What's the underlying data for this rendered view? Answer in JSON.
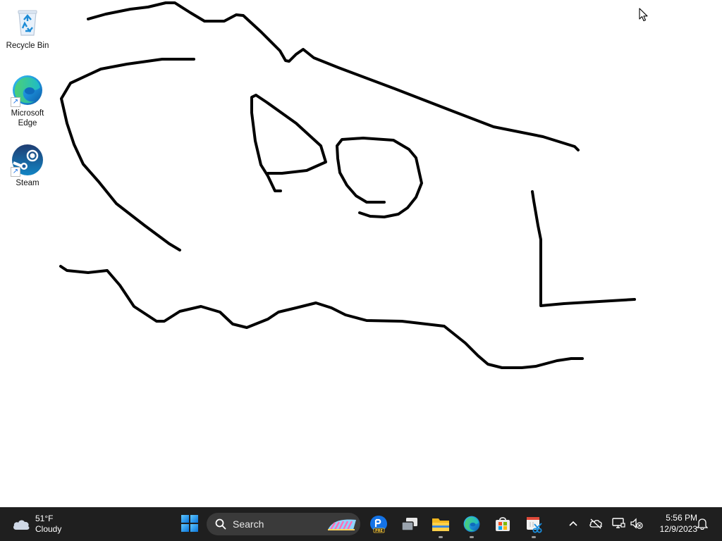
{
  "desktop": {
    "icons": [
      {
        "label": "Recycle Bin",
        "icon": "recycle-bin-icon"
      },
      {
        "label": "Microsoft Edge",
        "icon": "edge-icon"
      },
      {
        "label": "Steam",
        "icon": "steam-icon"
      }
    ]
  },
  "taskbar": {
    "weather": {
      "temp": "51°F",
      "condition": "Cloudy",
      "icon": "cloud-icon"
    },
    "search": {
      "label": "Search"
    },
    "apps": [
      {
        "name": "Photoshop Express",
        "icon": "photoshop-icon",
        "badge": "PRE"
      },
      {
        "name": "Task View",
        "icon": "task-view-icon"
      },
      {
        "name": "File Explorer",
        "icon": "folder-icon"
      },
      {
        "name": "Microsoft Edge",
        "icon": "edge-icon"
      },
      {
        "name": "Microsoft Store",
        "icon": "store-icon"
      },
      {
        "name": "Snipping Tool",
        "icon": "snipping-tool-icon"
      }
    ],
    "tray": [
      {
        "icon": "chevron-up-icon"
      },
      {
        "icon": "onedrive-off-icon"
      },
      {
        "icon": "network-icon"
      },
      {
        "icon": "volume-muted-icon"
      }
    ],
    "clock": {
      "time": "5:56 PM",
      "date": "12/9/2023"
    },
    "notifications_icon": "bell-icon"
  },
  "colors": {
    "desktop_bg": "#ffffff",
    "taskbar_bg": "#1f1f1f",
    "stroke": "#000000"
  }
}
